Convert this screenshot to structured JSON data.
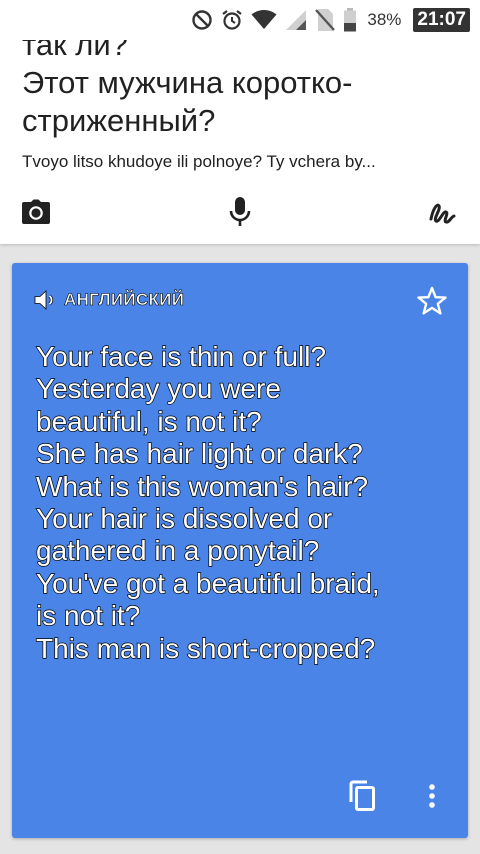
{
  "status_bar": {
    "battery_percent": "38%",
    "time": "21:07",
    "icons": [
      "blocked-icon",
      "alarm-icon",
      "wifi-icon",
      "signal-icon",
      "no-sim-icon",
      "battery-icon"
    ]
  },
  "source": {
    "text": "так ли?\nЭтот мужчина коротко-\nстриженный?",
    "transliteration": "Tvoyo litso khudoye ili polnoye? Ty vchera by...",
    "actions": {
      "camera": "camera-icon",
      "mic": "microphone-icon",
      "handwriting": "handwriting-icon"
    }
  },
  "result": {
    "language_label": "АНГЛИЙСКИЙ",
    "translation": "Your face is thin or full?\nYesterday you were\nbeautiful, is not it?\nShe has hair light or dark?\nWhat is this woman's hair?\nYour hair is dissolved or\ngathered in a ponytail?\nYou've got a beautiful braid,\nis not it?\nThis man is short-cropped?",
    "card_color": "#4a84e7"
  }
}
